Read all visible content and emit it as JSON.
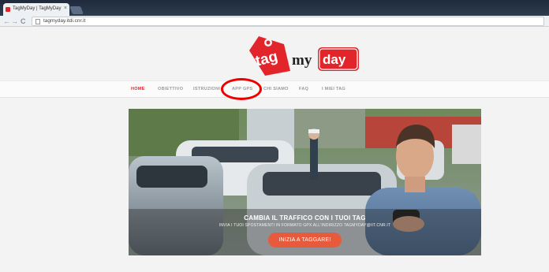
{
  "browser": {
    "tab_title": "TagMyDay | TagMyDay",
    "tab_close": "×",
    "url": "tagmyday.itdi.cnr.it",
    "back": "←",
    "forward": "→",
    "reload": "C"
  },
  "header": {
    "logo_text_1": "tag",
    "logo_text_2": "my",
    "logo_text_3": "day"
  },
  "nav": {
    "items": [
      {
        "label": "HOME",
        "active": true
      },
      {
        "label": "OBIETTIVO"
      },
      {
        "label": "ISTRUZIONI"
      },
      {
        "label": "APP GPS"
      },
      {
        "label": "CHI SIAMO"
      },
      {
        "label": "FAQ"
      },
      {
        "label": "I MIEI TAG"
      }
    ]
  },
  "hero": {
    "title": "CAMBIA IL TRAFFICO CON I TUOI TAG",
    "subtitle": "INVIA I TUOI SPOSTAMENTI IN FORMATO GPX ALL'INDIRIZZO TAGMYDAY@IIT.CNR.IT",
    "cta_label": "INIZIA A TAGGARE!"
  },
  "colors": {
    "brand_red": "#e2252b",
    "cta_orange": "#e85a3c",
    "annotation_red": "#ee0000"
  }
}
